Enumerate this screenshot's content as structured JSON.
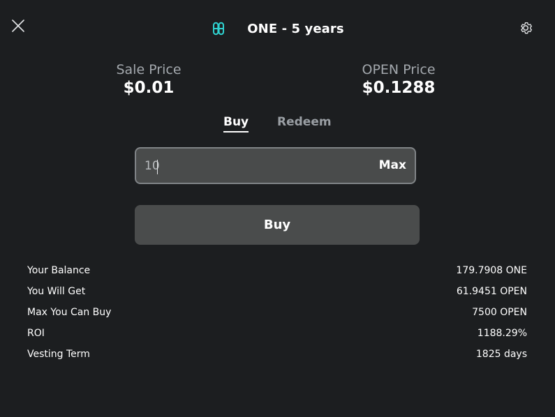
{
  "header": {
    "title": "ONE - 5 years",
    "logo_icon": "harmony-one-logo-icon",
    "close_icon": "close-icon",
    "settings_icon": "gear-icon",
    "accent_color": "#2fd3d1"
  },
  "prices": {
    "sale_label": "Sale Price",
    "sale_value": "$0.01",
    "open_label": "OPEN Price",
    "open_value": "$0.1288"
  },
  "tabs": [
    {
      "label": "Buy",
      "active": true
    },
    {
      "label": "Redeem",
      "active": false
    }
  ],
  "amount_input": {
    "value": "10",
    "max_label": "Max"
  },
  "action_button": {
    "label": "Buy"
  },
  "info": [
    {
      "label": "Your Balance",
      "value": "179.7908 ONE"
    },
    {
      "label": "You Will Get",
      "value": "61.9451 OPEN"
    },
    {
      "label": "Max You Can Buy",
      "value": "7500 OPEN"
    },
    {
      "label": "ROI",
      "value": "1188.29%"
    },
    {
      "label": "Vesting Term",
      "value": "1825 days"
    }
  ]
}
